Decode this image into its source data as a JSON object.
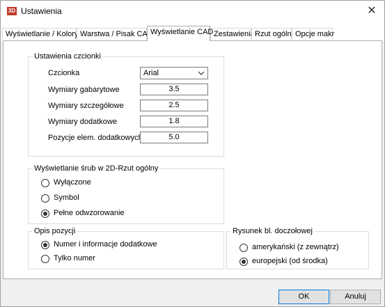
{
  "window": {
    "title": "Ustawienia",
    "icon": "app-logo-icon",
    "close_icon": "close-icon"
  },
  "tabs": [
    {
      "label": "Wyświetlanie / Kolory"
    },
    {
      "label": "Warstwa / Pisak CAD"
    },
    {
      "label": "Wyświetlanie CAD",
      "active": true
    },
    {
      "label": "Zestawienia"
    },
    {
      "label": "Rzut ogólny"
    },
    {
      "label": "Opcje makr"
    }
  ],
  "font_group": {
    "legend": "Ustawienia czcionki",
    "font_label": "Czcionka",
    "font_value": "Arial",
    "rows": [
      {
        "label": "Wymiary gabarytowe",
        "value": "3.5"
      },
      {
        "label": "Wymiary szczegółowe",
        "value": "2.5"
      },
      {
        "label": "Wymiary dodatkowe",
        "value": "1.8"
      },
      {
        "label": "Pozycje elem. dodatkowych",
        "value": "5.0"
      }
    ]
  },
  "screw_group": {
    "legend": "Wyświetlanie śrub w 2D-Rzut ogólny",
    "options": [
      {
        "label": "Wyłączone",
        "selected": false
      },
      {
        "label": "Symbol",
        "selected": false
      },
      {
        "label": "Pełne odwzorowanie",
        "selected": true
      }
    ]
  },
  "position_group": {
    "legend": "Opis pozycji",
    "options": [
      {
        "label": "Numer i informacje dodatkowe",
        "selected": true
      },
      {
        "label": "Tylko numer",
        "selected": false
      }
    ]
  },
  "drawing_group": {
    "legend": "Rysunek bl. doczołowej",
    "options": [
      {
        "label": "amerykański (z zewnątrz)",
        "selected": false
      },
      {
        "label": "europejski (od środka)",
        "selected": true
      }
    ]
  },
  "buttons": {
    "ok": "OK",
    "cancel": "Anuluj"
  }
}
